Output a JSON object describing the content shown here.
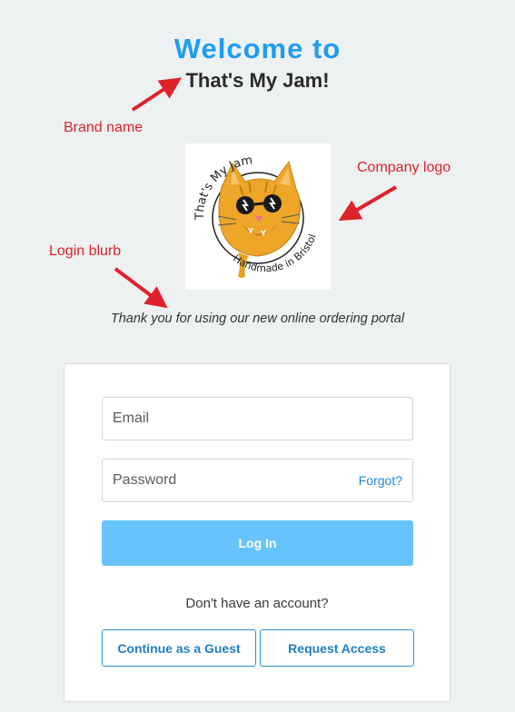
{
  "header": {
    "welcome": "Welcome to",
    "brand_name": "That's My Jam!"
  },
  "annotations": {
    "brand": "Brand name",
    "logo": "Company logo",
    "blurb": "Login blurb",
    "color": "#e0212b"
  },
  "logo": {
    "top_text": "That's My Jam",
    "bottom_text": "Handmade in Bristol"
  },
  "blurb": "Thank you for using our new online ordering portal",
  "login": {
    "email_placeholder": "Email",
    "email_value": "",
    "password_placeholder": "Password",
    "password_value": "",
    "forgot_label": "Forgot?",
    "login_label": "Log In",
    "no_account": "Don't have an account?",
    "guest_label": "Continue as a Guest",
    "request_label": "Request Access"
  },
  "colors": {
    "accent": "#1e9df3",
    "login_button": "#66c3fb",
    "background": "#eef1f2"
  }
}
